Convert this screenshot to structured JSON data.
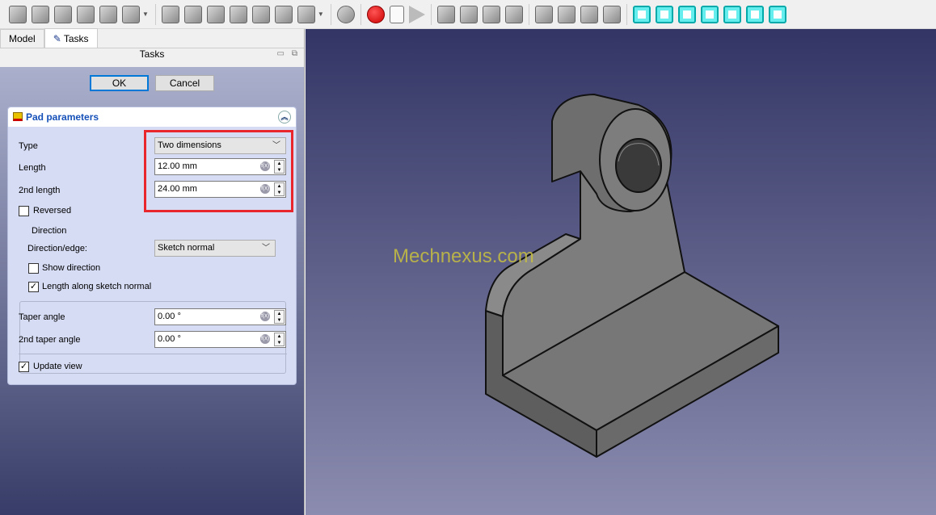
{
  "toolbar": {
    "icons": [
      "part-pad-icon",
      "part-revolution-icon",
      "part-loft-icon",
      "part-pipe-icon",
      "part-helix-icon",
      "part-primitive-icon",
      "pocket-icon",
      "hole-icon",
      "groove-icon",
      "subtractive-loft-icon",
      "subtractive-pipe-icon",
      "subtractive-helix-icon",
      "subtractive-primitive-icon",
      "boolean-icon",
      "macro-record-icon",
      "macro-edit-icon",
      "macro-run-icon",
      "view-front-icon",
      "view-top-icon",
      "view-right-icon",
      "view-rear-icon",
      "measure-icon",
      "measure-2-icon",
      "measure-3-icon",
      "measure-4-icon",
      "axo-view-icon",
      "front-view-icon",
      "top-view-icon",
      "right-view-icon",
      "rear-view-icon",
      "bottom-view-icon",
      "left-view-icon"
    ]
  },
  "tabs": [
    {
      "label": "Model"
    },
    {
      "label": "Tasks"
    }
  ],
  "tasks_title": "Tasks",
  "buttons": {
    "ok": "OK",
    "cancel": "Cancel"
  },
  "pad": {
    "title": "Pad parameters",
    "type_label": "Type",
    "type_value": "Two dimensions",
    "length_label": "Length",
    "length_value": "12.00 mm",
    "length2_label": "2nd length",
    "length2_value": "24.00 mm",
    "reversed_label": "Reversed",
    "reversed": false,
    "direction_group": "Direction",
    "direction_label": "Direction/edge:",
    "direction_value": "Sketch normal",
    "show_direction_label": "Show direction",
    "show_direction": false,
    "along_normal_label": "Length along sketch normal",
    "along_normal": true,
    "taper_label": "Taper angle",
    "taper_value": "0.00 °",
    "taper2_label": "2nd taper angle",
    "taper2_value": "0.00 °",
    "update_view_label": "Update view",
    "update_view": true
  },
  "watermark": "Mechnexus.com",
  "colors": {
    "highlight": "#e8262c",
    "accent": "#1550b8"
  }
}
